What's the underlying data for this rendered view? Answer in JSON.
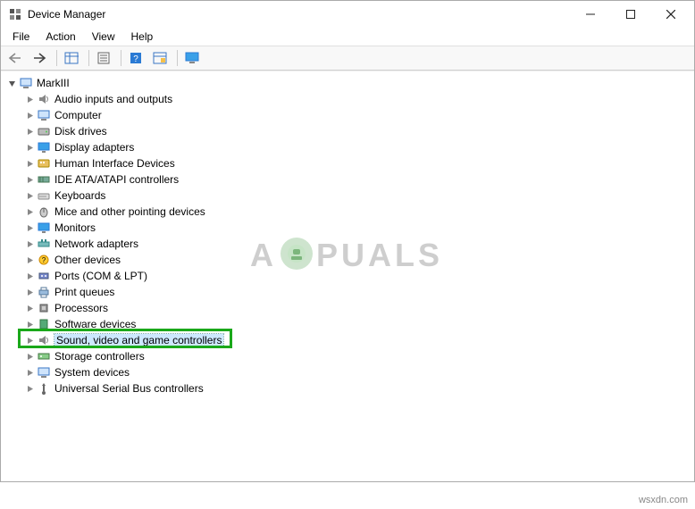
{
  "window": {
    "title": "Device Manager"
  },
  "menu": {
    "file": "File",
    "action": "Action",
    "view": "View",
    "help": "Help"
  },
  "tree": {
    "root": "MarkIII",
    "items": [
      "Audio inputs and outputs",
      "Computer",
      "Disk drives",
      "Display adapters",
      "Human Interface Devices",
      "IDE ATA/ATAPI controllers",
      "Keyboards",
      "Mice and other pointing devices",
      "Monitors",
      "Network adapters",
      "Other devices",
      "Ports (COM & LPT)",
      "Print queues",
      "Processors",
      "Software devices",
      "Sound, video and game controllers",
      "Storage controllers",
      "System devices",
      "Universal Serial Bus controllers"
    ]
  },
  "watermark": {
    "left": "A",
    "right": "PUALS"
  },
  "footer": {
    "source": "wsxdn.com"
  }
}
